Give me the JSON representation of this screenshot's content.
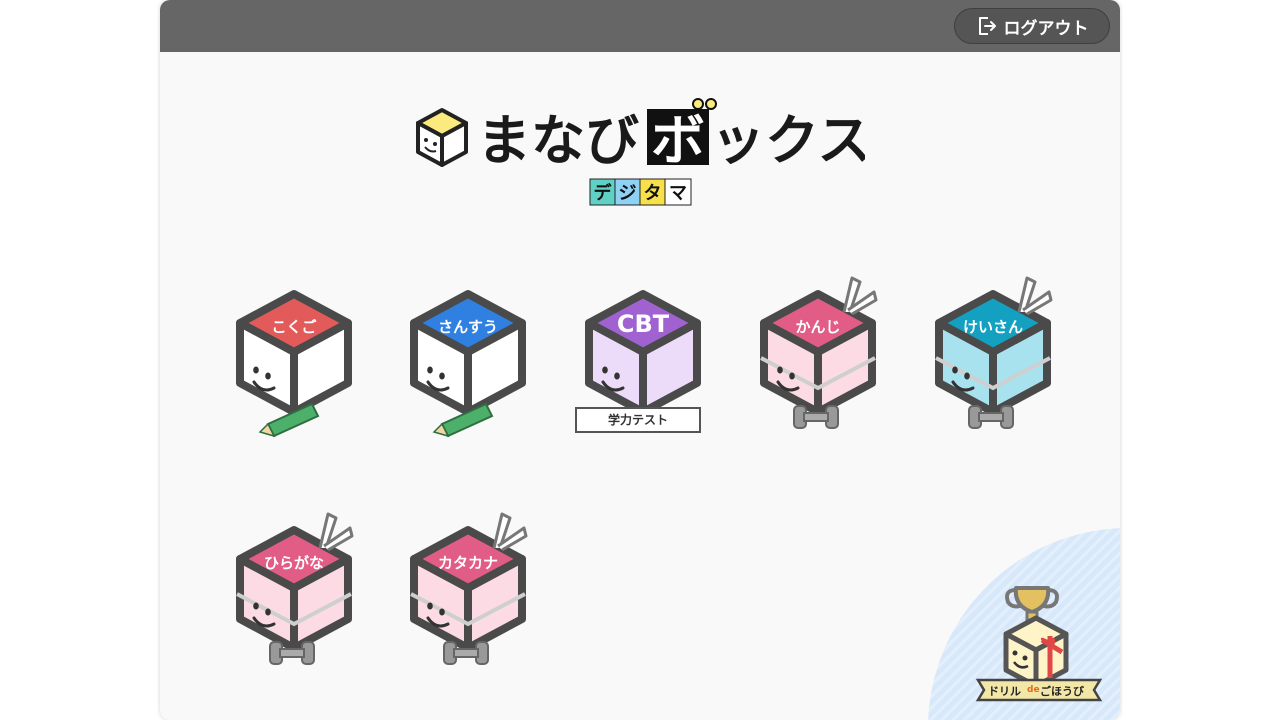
{
  "header": {
    "logout_label": "ログアウト",
    "logout_icon": "logout-icon"
  },
  "logo": {
    "title_hiragana": "まなび",
    "title_katakana_1": "ボ",
    "title_katakana_2": "ックス",
    "subtitle": [
      "デ",
      "ジ",
      "タ",
      "マ"
    ]
  },
  "tiles": [
    {
      "label": "こくご",
      "top_color": "#e35a5a",
      "body_color": "#ffffff",
      "accessory": "pencil"
    },
    {
      "label": "さんすう",
      "top_color": "#2f80e0",
      "body_color": "#ffffff",
      "accessory": "pencil"
    },
    {
      "label": "CBT",
      "top_color": "#a062d0",
      "body_color": "#ecdcfa",
      "accessory": "sign",
      "sign": "学力テスト"
    },
    {
      "label": "かんじ",
      "top_color": "#e25d86",
      "body_color": "#fcdbe5",
      "accessory": "dumbbell"
    },
    {
      "label": "けいさん",
      "top_color": "#14a0c0",
      "body_color": "#a8e2ef",
      "accessory": "dumbbell"
    },
    {
      "label": "ひらがな",
      "top_color": "#e25d86",
      "body_color": "#fcdbe5",
      "accessory": "dumbbell"
    },
    {
      "label": "カタカナ",
      "top_color": "#e25d86",
      "body_color": "#fcdbe5",
      "accessory": "dumbbell"
    }
  ],
  "reward": {
    "banner_prefix": "ドリル",
    "banner_de": "de",
    "banner_suffix": "ごほうび"
  },
  "colors": {
    "topbar": "#666666",
    "page": "#f9f9f9",
    "outline": "#4a4a4a"
  }
}
